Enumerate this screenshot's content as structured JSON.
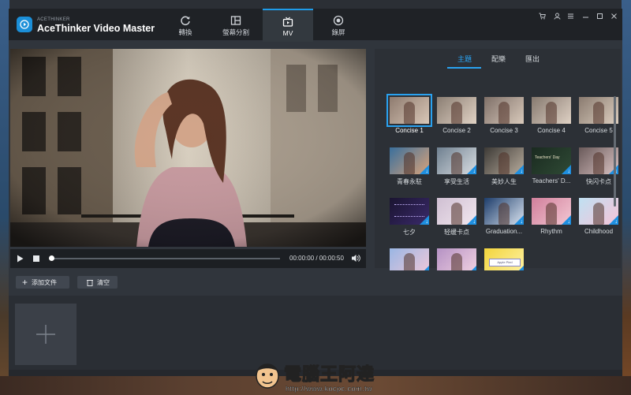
{
  "app": {
    "brand_small": "ACETHINKER",
    "title": "AceThinker Video Master"
  },
  "tabs": [
    {
      "label": "轉換",
      "icon": "refresh-icon"
    },
    {
      "label": "螢幕分割",
      "icon": "split-screen-icon"
    },
    {
      "label": "MV",
      "icon": "mv-icon",
      "active": true
    },
    {
      "label": "錄屏",
      "icon": "record-icon"
    }
  ],
  "window_controls": [
    "cart-icon",
    "user-icon",
    "menu-icon",
    "minimize-icon",
    "maximize-icon",
    "close-icon"
  ],
  "player": {
    "time": "00:00:00 / 00:00:50",
    "progress": 0
  },
  "subtabs": [
    {
      "label": "主題",
      "active": true
    },
    {
      "label": "配樂"
    },
    {
      "label": "匯出"
    }
  ],
  "themes": [
    {
      "label": "Concise 1",
      "selected": true,
      "download": false
    },
    {
      "label": "Concise 2",
      "download": false
    },
    {
      "label": "Concise 3",
      "download": false
    },
    {
      "label": "Concise 4",
      "download": false
    },
    {
      "label": "Concise 5",
      "download": false
    },
    {
      "label": "青春永駐",
      "download": true
    },
    {
      "label": "享受生活",
      "download": true
    },
    {
      "label": "美妙人生",
      "download": true
    },
    {
      "label": "Teachers' D...",
      "download": true
    },
    {
      "label": "快闪卡点",
      "download": true
    },
    {
      "label": "七夕",
      "download": true
    },
    {
      "label": "轻缓卡点",
      "download": true
    },
    {
      "label": "Graduation...",
      "download": true
    },
    {
      "label": "Rhythm",
      "download": true
    },
    {
      "label": "Childhood",
      "download": true
    },
    {
      "label": "",
      "download": true
    },
    {
      "label": "",
      "download": true
    },
    {
      "label": "",
      "download": true
    }
  ],
  "thumb_texts": {
    "teachers": "Teachers' Day",
    "last": "Apple Pied"
  },
  "toolbar": {
    "add_file": "添加文件",
    "clear": "清空"
  },
  "watermark": {
    "text": "電腦王阿達",
    "url": "http://www.kocpc.com.tw"
  },
  "colors": {
    "accent": "#2aa2f0",
    "titlebar": "#1f2226",
    "panel": "#30353c"
  }
}
